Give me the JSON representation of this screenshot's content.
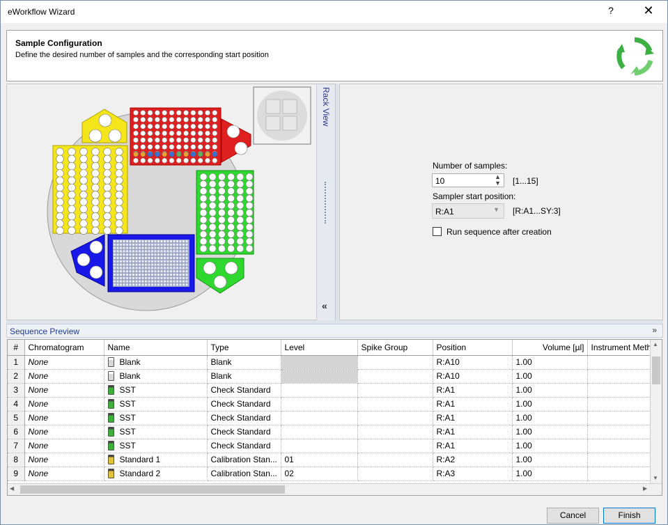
{
  "window": {
    "title": "eWorkflow Wizard",
    "help_label": "?",
    "close_label": "✕"
  },
  "header": {
    "title": "Sample Configuration",
    "subtitle": "Define the desired number of samples and the corresponding start position"
  },
  "rack": {
    "side_label": "Rack View",
    "collapse_label": "«"
  },
  "config": {
    "num_samples_label": "Number of samples:",
    "num_samples_value": "10",
    "num_samples_range": "[1...15]",
    "start_position_label": "Sampler start position:",
    "start_position_value": "R:A1",
    "start_position_range": "[R:A1...SY:3]",
    "run_sequence_label": "Run sequence after creation",
    "run_sequence_checked": false
  },
  "sequence": {
    "label": "Sequence Preview",
    "expand_icon": "»",
    "columns": [
      "#",
      "Chromatogram",
      "Name",
      "Type",
      "Level",
      "Spike Group",
      "Position",
      "Volume [µl]",
      "Instrument Metho"
    ],
    "rows": [
      {
        "num": "1",
        "chrom": "None",
        "name": "Blank",
        "icon": "blank",
        "type": "Blank",
        "level": "",
        "level_shaded": true,
        "spike": "",
        "position": "R:A10",
        "volume": "1.00",
        "method": ""
      },
      {
        "num": "2",
        "chrom": "None",
        "name": "Blank",
        "icon": "blank",
        "type": "Blank",
        "level": "",
        "level_shaded": true,
        "spike": "",
        "position": "R:A10",
        "volume": "1.00",
        "method": ""
      },
      {
        "num": "3",
        "chrom": "None",
        "name": "SST",
        "icon": "check",
        "type": "Check Standard",
        "level": "",
        "level_shaded": false,
        "spike": "",
        "position": "R:A1",
        "volume": "1.00",
        "method": ""
      },
      {
        "num": "4",
        "chrom": "None",
        "name": "SST",
        "icon": "check",
        "type": "Check Standard",
        "level": "",
        "level_shaded": false,
        "spike": "",
        "position": "R:A1",
        "volume": "1.00",
        "method": ""
      },
      {
        "num": "5",
        "chrom": "None",
        "name": "SST",
        "icon": "check",
        "type": "Check Standard",
        "level": "",
        "level_shaded": false,
        "spike": "",
        "position": "R:A1",
        "volume": "1.00",
        "method": ""
      },
      {
        "num": "6",
        "chrom": "None",
        "name": "SST",
        "icon": "check",
        "type": "Check Standard",
        "level": "",
        "level_shaded": false,
        "spike": "",
        "position": "R:A1",
        "volume": "1.00",
        "method": ""
      },
      {
        "num": "7",
        "chrom": "None",
        "name": "SST",
        "icon": "check",
        "type": "Check Standard",
        "level": "",
        "level_shaded": false,
        "spike": "",
        "position": "R:A1",
        "volume": "1.00",
        "method": ""
      },
      {
        "num": "8",
        "chrom": "None",
        "name": "Standard 1",
        "icon": "std",
        "type": "Calibration Stan...",
        "level": "01",
        "level_shaded": false,
        "spike": "",
        "position": "R:A2",
        "volume": "1.00",
        "method": ""
      },
      {
        "num": "9",
        "chrom": "None",
        "name": "Standard 2",
        "icon": "std",
        "type": "Calibration Stan...",
        "level": "02",
        "level_shaded": false,
        "spike": "",
        "position": "R:A3",
        "volume": "1.00",
        "method": ""
      }
    ]
  },
  "buttons": {
    "cancel": "Cancel",
    "finish": "Finish"
  },
  "colors": {
    "rack_red": "#e02020",
    "rack_yellow": "#f5e61c",
    "rack_green": "#2fd82f",
    "rack_blue": "#1818e8",
    "logo_green": "#3cb043",
    "accent_blue": "#1f3a8a"
  }
}
